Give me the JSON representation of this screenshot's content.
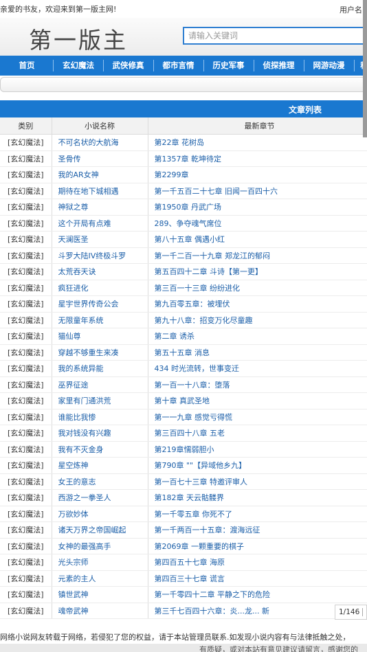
{
  "topbar": {
    "welcome": "亲爱的书友，欢迎来到第一版主网!",
    "user_label": "用户名:"
  },
  "header": {
    "logo": "第一版主",
    "search_placeholder": "请输入关键词"
  },
  "nav": {
    "items": [
      "首页",
      "玄幻魔法",
      "武侠修真",
      "都市言情",
      "历史军事",
      "侦探推理",
      "网游动漫",
      "科"
    ]
  },
  "list": {
    "title": "文章列表",
    "columns": [
      "类别",
      "小说名称",
      "最新章节"
    ],
    "rows": [
      {
        "category": "[玄幻魔法]",
        "name": "不可名状的大航海",
        "chapter": "第22章 花树岛"
      },
      {
        "category": "[玄幻魔法]",
        "name": "圣骨传",
        "chapter": "第1357章 乾坤待定"
      },
      {
        "category": "[玄幻魔法]",
        "name": "我的AR女神",
        "chapter": "第2299章"
      },
      {
        "category": "[玄幻魔法]",
        "name": "期待在地下城相遇",
        "chapter": "第一千五百二十七章 旧闻一百四十六"
      },
      {
        "category": "[玄幻魔法]",
        "name": "神狱之尊",
        "chapter": "第1950章 丹武广场"
      },
      {
        "category": "[玄幻魔法]",
        "name": "这个开局有点难",
        "chapter": "289、争夺魂气席位"
      },
      {
        "category": "[玄幻魔法]",
        "name": "天澜医圣",
        "chapter": "第八十五章 偶遇小红"
      },
      {
        "category": "[玄幻魔法]",
        "name": "斗罗大陆IV终极斗罗",
        "chapter": "第一千二百一十九章 郑龙江的郁闷"
      },
      {
        "category": "[玄幻魔法]",
        "name": "太荒吞天诀",
        "chapter": "第五百四十二章 斗诗【第一更】"
      },
      {
        "category": "[玄幻魔法]",
        "name": "疯狂进化",
        "chapter": "第三百一十三章 纷纷进化"
      },
      {
        "category": "[玄幻魔法]",
        "name": "星宇世界传奇公会",
        "chapter": "第九百零五章：被埋伏"
      },
      {
        "category": "[玄幻魔法]",
        "name": "无限童年系统",
        "chapter": "第九十八章：招变万化尽童趣"
      },
      {
        "category": "[玄幻魔法]",
        "name": "猫仙尊",
        "chapter": "第二章 诱杀"
      },
      {
        "category": "[玄幻魔法]",
        "name": "穿越不够重生来凑",
        "chapter": "第五十五章 消息"
      },
      {
        "category": "[玄幻魔法]",
        "name": "我的系统异能",
        "chapter": "434 时光流转，世事变迁"
      },
      {
        "category": "[玄幻魔法]",
        "name": "巫界征途",
        "chapter": "第一百一十八章：堕落"
      },
      {
        "category": "[玄幻魔法]",
        "name": "家里有门通洪荒",
        "chapter": "第十章 真武圣地"
      },
      {
        "category": "[玄幻魔法]",
        "name": "谁能比我惨",
        "chapter": "第一一九章 感觉亏得慌"
      },
      {
        "category": "[玄幻魔法]",
        "name": "我对钱没有兴趣",
        "chapter": "第三百四十八章 五老"
      },
      {
        "category": "[玄幻魔法]",
        "name": "我有不灭金身",
        "chapter": "第219章懦弱胆小"
      },
      {
        "category": "[玄幻魔法]",
        "name": "星空炼神",
        "chapter": "第790章 \"\"【异域他乡九】"
      },
      {
        "category": "[玄幻魔法]",
        "name": "女王的意志",
        "chapter": "第一百七十三章 特邀评审人"
      },
      {
        "category": "[玄幻魔法]",
        "name": "西游之一拳圣人",
        "chapter": "第182章 天云骷髅界"
      },
      {
        "category": "[玄幻魔法]",
        "name": "万欲妙体",
        "chapter": "第一千零五章 你死不了"
      },
      {
        "category": "[玄幻魔法]",
        "name": "诸天万界之帝国崛起",
        "chapter": "第一千两百一十五章：渡海远征"
      },
      {
        "category": "[玄幻魔法]",
        "name": "女神的最强高手",
        "chapter": "第2069章 一颗重要的棋子"
      },
      {
        "category": "[玄幻魔法]",
        "name": "光头宗师",
        "chapter": "第四百五十七章 海原"
      },
      {
        "category": "[玄幻魔法]",
        "name": "元素的主人",
        "chapter": "第四百三十七章 谎言"
      },
      {
        "category": "[玄幻魔法]",
        "name": "镇世武神",
        "chapter": "第一千零四十二章 平静之下的危险"
      },
      {
        "category": "[玄幻魔法]",
        "name": "魂帝武神",
        "chapter": "第三千七百四十六章：炎...龙... 新"
      }
    ]
  },
  "pager": {
    "text": "1/146"
  },
  "footer": {
    "note": "网络小说网友转载于网络，若侵犯了您的权益，请于本站管理员联系.如发现小说内容有与法律抵触之处，",
    "note2": "有质疑，或对本站有意见建议请留言，感谢您的"
  }
}
